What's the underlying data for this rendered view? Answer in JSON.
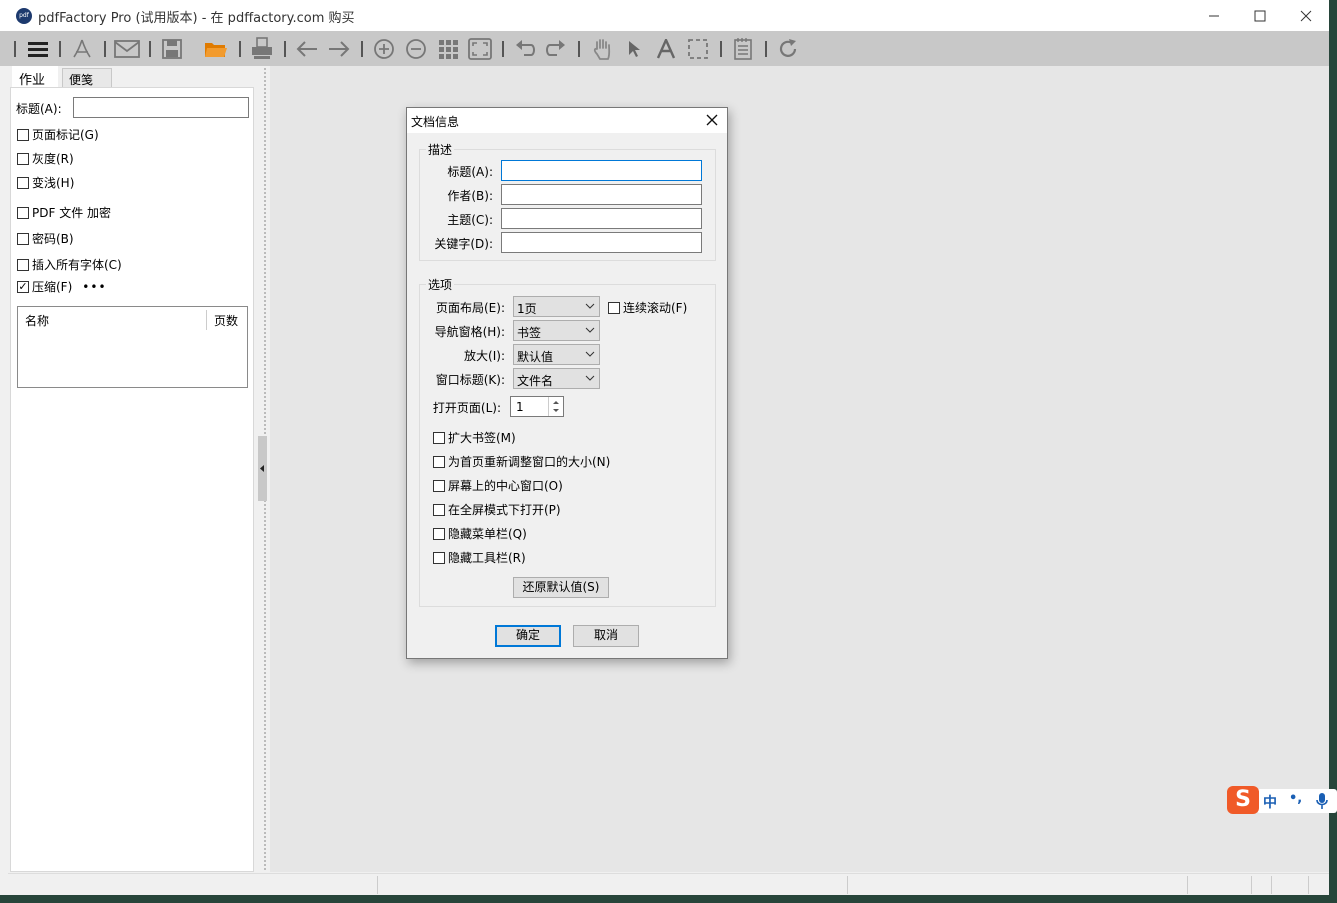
{
  "window": {
    "icon_text": "pdf",
    "title": "pdfFactory Pro (试用版本) - 在 pdffactory.com 购买"
  },
  "toolbar": {
    "icons": [
      "menu-icon",
      "acrobat-icon",
      "email-icon",
      "save-icon",
      "open-folder-icon",
      "print-icon",
      "back-arrow-icon",
      "forward-arrow-icon",
      "zoom-in-icon",
      "zoom-out-icon",
      "grid-icon",
      "fit-page-icon",
      "undo-icon",
      "redo-icon",
      "hand-icon",
      "pointer-icon",
      "text-icon",
      "select-rect-icon",
      "notes-icon",
      "refresh-icon"
    ]
  },
  "left_panel": {
    "tabs": [
      "作业",
      "便笺"
    ],
    "title_label": "标题(A):",
    "title_value": "",
    "checkboxes": [
      {
        "label": "页面标记(G)",
        "checked": false
      },
      {
        "label": "灰度(R)",
        "checked": false
      },
      {
        "label": "变浅(H)",
        "checked": false
      },
      {
        "label": "PDF 文件 加密",
        "checked": false
      },
      {
        "label": "密码(B)",
        "checked": false
      },
      {
        "label": "插入所有字体(C)",
        "checked": false
      },
      {
        "label": "压缩(F)",
        "checked": true
      }
    ],
    "compress_more": "•••",
    "list_headers": [
      "名称",
      "页数"
    ]
  },
  "dialog": {
    "title": "文档信息",
    "desc_group": "描述",
    "desc_fields": [
      {
        "label": "标题(A):",
        "value": ""
      },
      {
        "label": "作者(B):",
        "value": ""
      },
      {
        "label": "主题(C):",
        "value": ""
      },
      {
        "label": "关键字(D):",
        "value": ""
      }
    ],
    "options_group": "选项",
    "page_layout_label": "页面布局(E):",
    "page_layout_value": "1页",
    "continuous_scroll_label": "连续滚动(F)",
    "nav_pane_label": "导航窗格(H):",
    "nav_pane_value": "书签",
    "zoom_label": "放大(I):",
    "zoom_value": "默认值",
    "window_title_label": "窗口标题(K):",
    "window_title_value": "文件名",
    "open_page_label": "打开页面(L):",
    "open_page_value": "1",
    "option_checks": [
      "扩大书签(M)",
      "为首页重新调整窗口的大小(N)",
      "屏幕上的中心窗口(O)",
      "在全屏模式下打开(P)",
      "隐藏菜单栏(Q)",
      "隐藏工具栏(R)"
    ],
    "restore_defaults": "还原默认值(S)",
    "ok": "确定",
    "cancel": "取消"
  },
  "ime": {
    "logo": "S",
    "mode": "中",
    "punct": "•,",
    "icon": "microphone-icon"
  },
  "colors": {
    "accent": "#0078d7",
    "folder": "#e07b00",
    "desktop": "#27453a",
    "ime_brand": "#f05a28"
  }
}
